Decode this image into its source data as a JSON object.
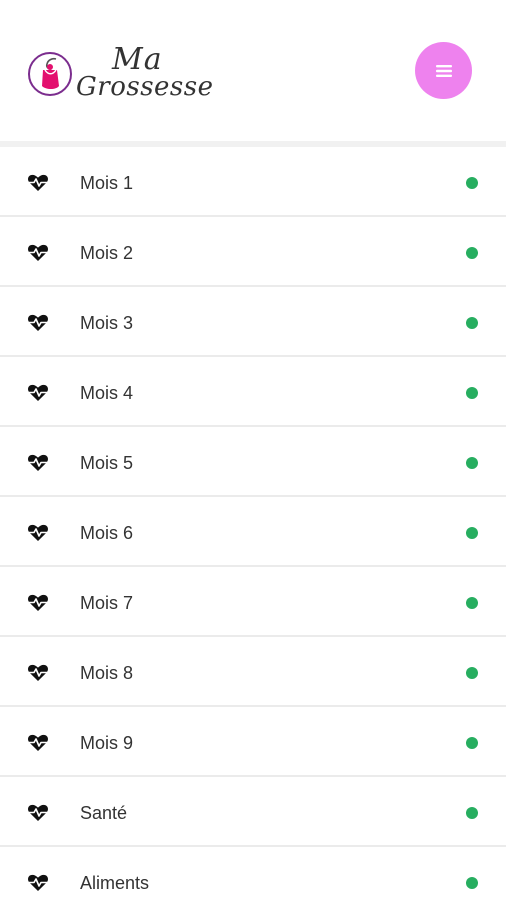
{
  "colors": {
    "menu_button": "#ee82ee",
    "status_dot": "#27ae60",
    "logo_pink": "#e3106e",
    "logo_ring": "#7b2d8e"
  },
  "header": {
    "logo": {
      "line1": "Ma",
      "line2": "Grossesse"
    },
    "menu_icon": "hamburger-menu-icon"
  },
  "items": [
    {
      "label": "Mois 1",
      "icon": "heartbeat-icon",
      "status": "green-dot"
    },
    {
      "label": "Mois 2",
      "icon": "heartbeat-icon",
      "status": "green-dot"
    },
    {
      "label": "Mois 3",
      "icon": "heartbeat-icon",
      "status": "green-dot"
    },
    {
      "label": "Mois 4",
      "icon": "heartbeat-icon",
      "status": "green-dot"
    },
    {
      "label": "Mois 5",
      "icon": "heartbeat-icon",
      "status": "green-dot"
    },
    {
      "label": "Mois 6",
      "icon": "heartbeat-icon",
      "status": "green-dot"
    },
    {
      "label": "Mois 7",
      "icon": "heartbeat-icon",
      "status": "green-dot"
    },
    {
      "label": "Mois 8",
      "icon": "heartbeat-icon",
      "status": "green-dot"
    },
    {
      "label": "Mois 9",
      "icon": "heartbeat-icon",
      "status": "green-dot"
    },
    {
      "label": "Santé",
      "icon": "heartbeat-icon",
      "status": "green-dot"
    },
    {
      "label": "Aliments",
      "icon": "heartbeat-icon",
      "status": "green-dot"
    }
  ]
}
